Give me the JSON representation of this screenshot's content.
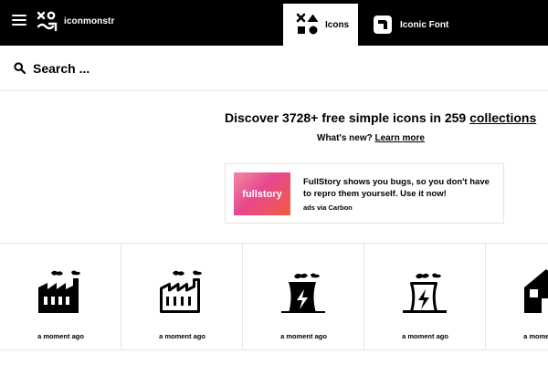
{
  "header": {
    "brand": "iconmonstr",
    "tabs": [
      {
        "label": "Icons",
        "icon": "shapes-icon",
        "active": true
      },
      {
        "label": "Iconic Font",
        "icon": "font-icon",
        "active": false
      }
    ]
  },
  "search": {
    "placeholder": "Search ...",
    "value": ""
  },
  "hero": {
    "headline_prefix": "Discover 3728+ free simple icons in 259 ",
    "headline_link": "collections",
    "whatsnew_prefix": "What's new? ",
    "whatsnew_link": "Learn more"
  },
  "ad": {
    "image_text": "fullstory",
    "text": "FullStory shows you bugs, so you don't have to repro them yourself. Use it now!",
    "via": "ads via Carbon"
  },
  "grid": {
    "items": [
      {
        "icon": "factory-icon",
        "time": "a moment ago"
      },
      {
        "icon": "factory-outline-icon",
        "time": "a moment ago"
      },
      {
        "icon": "power-plant-icon",
        "time": "a moment ago"
      },
      {
        "icon": "power-plant-outline-icon",
        "time": "a moment ago"
      },
      {
        "icon": "house-icon",
        "time": "a moment ago"
      }
    ]
  },
  "colors": {
    "header_bg": "#000000",
    "accent_gradient": [
      "#f08aa0",
      "#e8478f",
      "#ef5f3c"
    ]
  }
}
